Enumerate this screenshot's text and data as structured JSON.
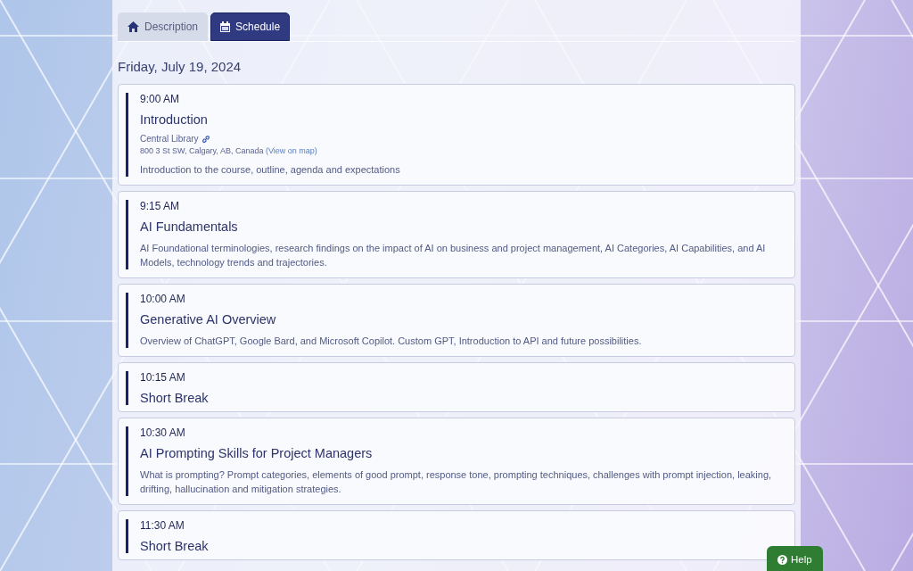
{
  "tabs": [
    {
      "label": "Description",
      "kind": "home",
      "selected": false
    },
    {
      "label": "Schedule",
      "kind": "calendar",
      "selected": true
    }
  ],
  "schedule": {
    "date": "Friday, July 19, 2024",
    "items": [
      {
        "time": "9:00 AM",
        "title": "Introduction",
        "location": {
          "name": "Central Library",
          "address": "800 3 St SW, Calgary, AB, Canada",
          "map_link": "(View on map)"
        },
        "description": "Introduction to the course, outline, agenda and expectations"
      },
      {
        "time": "9:15 AM",
        "title": "AI Fundamentals",
        "description": "AI Foundational terminologies, research findings on the impact of AI on business and project management, AI Categories, AI Capabilities, and AI Models, technology trends and trajectories."
      },
      {
        "time": "10:00 AM",
        "title": "Generative AI Overview",
        "description": "Overview of ChatGPT, Google Bard, and Microsoft Copilot. Custom GPT, Introduction to API and future possibilities."
      },
      {
        "time": "10:15 AM",
        "title": "Short Break"
      },
      {
        "time": "10:30 AM",
        "title": "AI Prompting Skills for Project Managers",
        "description": "What is prompting? Prompt categories, elements of good prompt, response tone, prompting techniques, challenges with prompt injection, leaking, drifting, hallucination and mitigation strategies."
      },
      {
        "time": "11:30 AM",
        "title": "Short Break"
      }
    ]
  },
  "help_button": {
    "label": "Help"
  }
}
